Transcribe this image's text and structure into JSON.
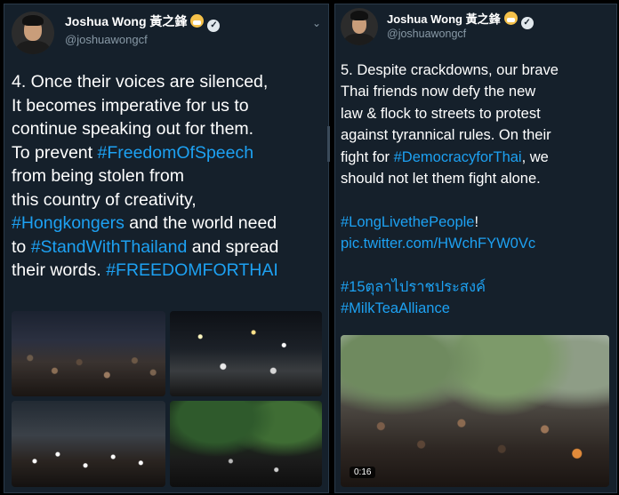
{
  "left": {
    "author": {
      "name": "Joshua Wong 黃之鋒",
      "handle": "@joshuawongcf"
    },
    "tweet_lines": [
      [
        {
          "t": "4. Once their voices are silenced,"
        }
      ],
      [
        {
          "t": "It becomes imperative for us to"
        }
      ],
      [
        {
          "t": "continue speaking out for them."
        }
      ],
      [
        {
          "t": "To prevent "
        },
        {
          "t": "#FreedomOfSpeech",
          "tag": true
        }
      ],
      [
        {
          "t": "from being stolen from"
        }
      ],
      [
        {
          "t": "this country of creativity,"
        }
      ],
      [
        {
          "t": "#Hongkongers",
          "tag": true
        },
        {
          "t": " and the world need"
        }
      ],
      [
        {
          "t": "to "
        },
        {
          "t": "#StandWithThailand",
          "tag": true
        },
        {
          "t": " and spread"
        }
      ],
      [
        {
          "t": "their words. "
        },
        {
          "t": "#FREEDOMFORTHAI",
          "tag": true
        }
      ]
    ]
  },
  "right": {
    "author": {
      "name": "Joshua Wong 黃之鋒",
      "handle": "@joshuawongcf"
    },
    "tweet_lines": [
      [
        {
          "t": "5. Despite crackdowns, our brave"
        }
      ],
      [
        {
          "t": "Thai friends now defy the new"
        }
      ],
      [
        {
          "t": "law & flock to streets to protest"
        }
      ],
      [
        {
          "t": "against tyrannical rules. On their"
        }
      ],
      [
        {
          "t": "fight for "
        },
        {
          "t": "#DemocracyforThai",
          "tag": true
        },
        {
          "t": ", we"
        }
      ],
      [
        {
          "t": "should not let them fight alone."
        }
      ],
      [
        {
          "t": ""
        }
      ],
      [
        {
          "t": "#LongLivethePeople",
          "tag": true
        },
        {
          "t": "!"
        }
      ],
      [
        {
          "t": "pic.twitter.com/HWchFYW0Vc",
          "tag": true
        }
      ],
      [
        {
          "t": ""
        }
      ],
      [
        {
          "t": "#15ตุลาไปราชประสงค์",
          "tag": true
        }
      ],
      [
        {
          "t": "#MilkTeaAlliance",
          "tag": true
        }
      ]
    ],
    "video_duration": "0:16"
  },
  "colors": {
    "background": "#15202b",
    "hashtag": "#1da1f2",
    "text": "#ffffff",
    "secondary": "#8899a6"
  },
  "icons": [
    "avatar",
    "face-mask-emoji-icon",
    "verified-badge-icon",
    "chevron-down-icon"
  ]
}
